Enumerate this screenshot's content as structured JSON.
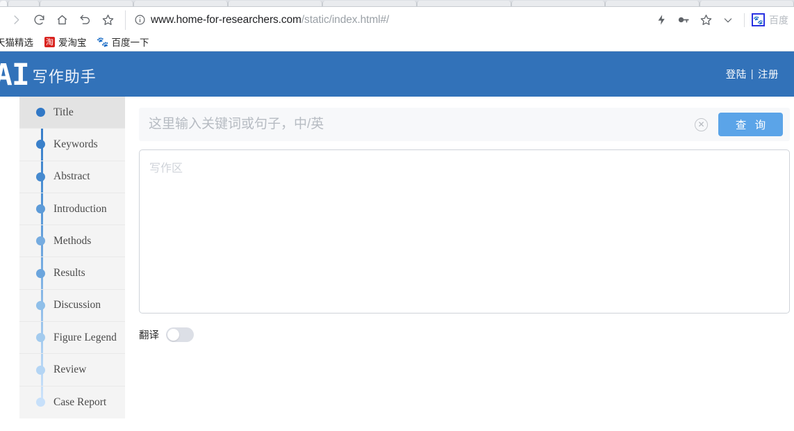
{
  "browser": {
    "nav": {
      "forward_icon": "chevron-right-icon",
      "reload_icon": "reload-icon",
      "home_icon": "home-icon",
      "back_history_icon": "undo-arrow-icon",
      "bookmark_star_icon": "star-icon"
    },
    "url": {
      "info_icon": "info-circle-icon",
      "domain": "www.home-for-researchers.com",
      "path": "/static/index.html#/"
    },
    "toolbar_right": {
      "flash_icon": "lightning-bolt-icon",
      "password_icon": "key-icon",
      "favorite_icon": "star-outline-icon",
      "menu_icon": "chevron-down-icon",
      "extension_icon": "baidu-paw-icon",
      "extension_label": "百度"
    },
    "bookmarks": [
      {
        "label": "天猫精选",
        "icon": "none"
      },
      {
        "label": "爱淘宝",
        "icon": "taobao-icon"
      },
      {
        "label": "百度一下",
        "icon": "baidu-paw-icon"
      }
    ]
  },
  "app": {
    "header": {
      "logo_mark": "AI",
      "logo_text": "写作助手",
      "login_label": "登陆",
      "divider": "|",
      "register_label": "注册",
      "background_color": "#3272b9"
    },
    "sidebar": {
      "active_index": 0,
      "items": [
        {
          "label": "Title",
          "dot_color": "#3178c6"
        },
        {
          "label": "Keywords",
          "dot_color": "#3a80ca"
        },
        {
          "label": "Abstract",
          "dot_color": "#468acf"
        },
        {
          "label": "Introduction",
          "dot_color": "#5d9bd8"
        },
        {
          "label": "Methods",
          "dot_color": "#76ace0"
        },
        {
          "label": "Results",
          "dot_color": "#6ba5dd"
        },
        {
          "label": "Discussion",
          "dot_color": "#8fbfe9"
        },
        {
          "label": "Figure Legend",
          "dot_color": "#a3cbee"
        },
        {
          "label": "Review",
          "dot_color": "#b4d5f4"
        },
        {
          "label": "Case Report",
          "dot_color": "#c7e0fa"
        }
      ]
    },
    "search": {
      "placeholder": "这里输入关键词或句子，中/英",
      "value": "",
      "clear_icon": "clear-circle-x-icon",
      "button_label": "查 询",
      "button_color": "#5ba4e8"
    },
    "editor": {
      "placeholder": "写作区",
      "value": ""
    },
    "translate": {
      "label": "翻译",
      "enabled": false
    }
  }
}
